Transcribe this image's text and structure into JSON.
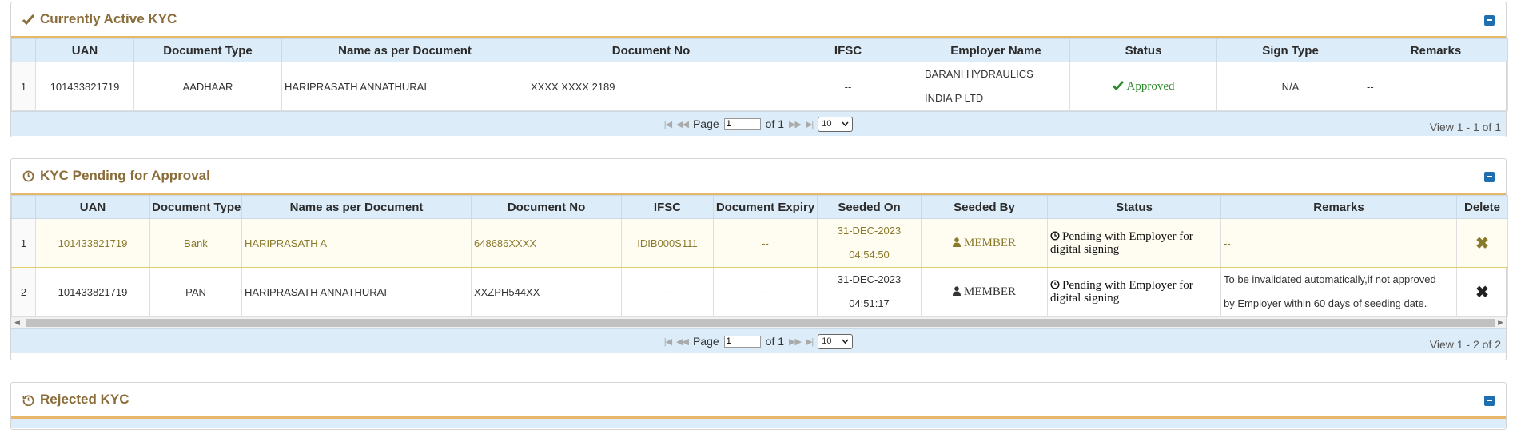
{
  "active": {
    "title": "Currently Active KYC",
    "icon": "check-icon",
    "columns": [
      "UAN",
      "Document Type",
      "Name as per Document",
      "Document No",
      "IFSC",
      "Employer Name",
      "Status",
      "Sign Type",
      "Remarks"
    ],
    "rows": [
      {
        "num": "1",
        "uan": "101433821719",
        "doc_type": "AADHAAR",
        "name": "HARIPRASATH ANNATHURAI",
        "doc_no": "XXXX XXXX 2189",
        "ifsc": "--",
        "employer_line1": "BARANI HYDRAULICS",
        "employer_line2": "INDIA P LTD",
        "status": "Approved",
        "sign_type": "N/A",
        "remarks": "--"
      }
    ],
    "pager": {
      "page_label": "Page",
      "page_value": "1",
      "of_label": "of 1",
      "per_page": "10",
      "view": "View 1 - 1 of 1"
    }
  },
  "pending": {
    "title": "KYC Pending for Approval",
    "icon": "clock-icon",
    "columns": [
      "UAN",
      "Document Type",
      "Name as per Document",
      "Document No",
      "IFSC",
      "Document Expiry",
      "Seeded On",
      "Seeded By",
      "Status",
      "Remarks",
      "Delete"
    ],
    "rows": [
      {
        "num": "1",
        "uan": "101433821719",
        "doc_type": "Bank",
        "name": "HARIPRASATH A",
        "doc_no": "648686XXXX",
        "ifsc": "IDIB000S111",
        "expiry": "--",
        "seeded_date": "31-DEC-2023",
        "seeded_time": "04:54:50",
        "seeded_by": "MEMBER",
        "status": "Pending with Employer for digital signing",
        "remarks": "--"
      },
      {
        "num": "2",
        "uan": "101433821719",
        "doc_type": "PAN",
        "name": "HARIPRASATH ANNATHURAI",
        "doc_no": "XXZPH544XX",
        "ifsc": "--",
        "expiry": "--",
        "seeded_date": "31-DEC-2023",
        "seeded_time": "04:51:17",
        "seeded_by": "MEMBER",
        "status": "Pending with Employer for digital signing",
        "remarks_line1": "To be invalidated automatically,if not approved",
        "remarks_line2": "by Employer within 60 days of seeding date."
      }
    ],
    "pager": {
      "page_label": "Page",
      "page_value": "1",
      "of_label": "of 1",
      "per_page": "10",
      "view": "View 1 - 2 of 2"
    }
  },
  "rejected": {
    "title": "Rejected KYC",
    "icon": "history-icon"
  },
  "colors": {
    "title": "#8a6d3b",
    "header_bg": "#dcecf8",
    "accent_border": "#e8b86a",
    "approved": "#2e8b2e",
    "highlight_text": "#8a7a2c",
    "collapse_btn": "#1f6fb0"
  }
}
